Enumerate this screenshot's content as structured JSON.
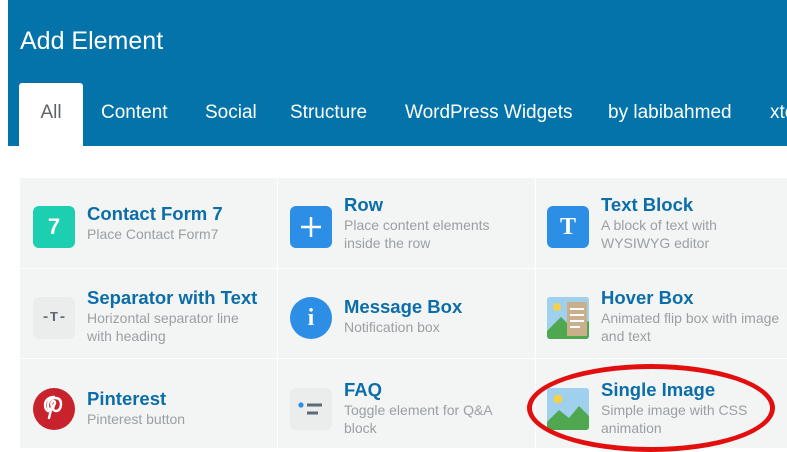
{
  "dialog": {
    "title": "Add Element"
  },
  "tabs": [
    "All",
    "Content",
    "Social",
    "Structure",
    "WordPress Widgets",
    "by labibahmed",
    "xte"
  ],
  "elements": [
    {
      "name": "Contact Form 7",
      "desc": "Place Contact Form7",
      "icon": "contact-form-7-icon",
      "glyph": "7",
      "color": "#1ccfb1"
    },
    {
      "name": "Row",
      "desc": "Place content elements inside the row",
      "icon": "plus-icon",
      "glyph": "+",
      "color": "#2d8ee6"
    },
    {
      "name": "Text Block",
      "desc": "A block of text with WYSIWYG editor",
      "icon": "text-block-icon",
      "glyph": "T",
      "color": "#2d8ee6"
    },
    {
      "name": "Separator with Text",
      "desc": "Horizontal separator line with heading",
      "icon": "separator-icon",
      "glyph": "-T-",
      "color": "#ebecec"
    },
    {
      "name": "Message Box",
      "desc": "Notification box",
      "icon": "info-icon",
      "glyph": "i",
      "color": "#2d8ee6"
    },
    {
      "name": "Hover Box",
      "desc": "Animated flip box with image and text",
      "icon": "hover-box-icon",
      "glyph": "",
      "color": "#9fd0ee"
    },
    {
      "name": "Pinterest",
      "desc": "Pinterest button",
      "icon": "pinterest-icon",
      "glyph": "P",
      "color": "#c8232c"
    },
    {
      "name": "FAQ",
      "desc": "Toggle element for Q&A block",
      "icon": "faq-icon",
      "glyph": "",
      "color": "#ebecec"
    },
    {
      "name": "Single Image",
      "desc": "Simple image with CSS animation",
      "icon": "image-icon",
      "glyph": "",
      "color": "#9fd0ee"
    }
  ],
  "colors": {
    "header": "#0473aa",
    "highlight": "#e20f0f",
    "link": "#0b6ea8"
  }
}
